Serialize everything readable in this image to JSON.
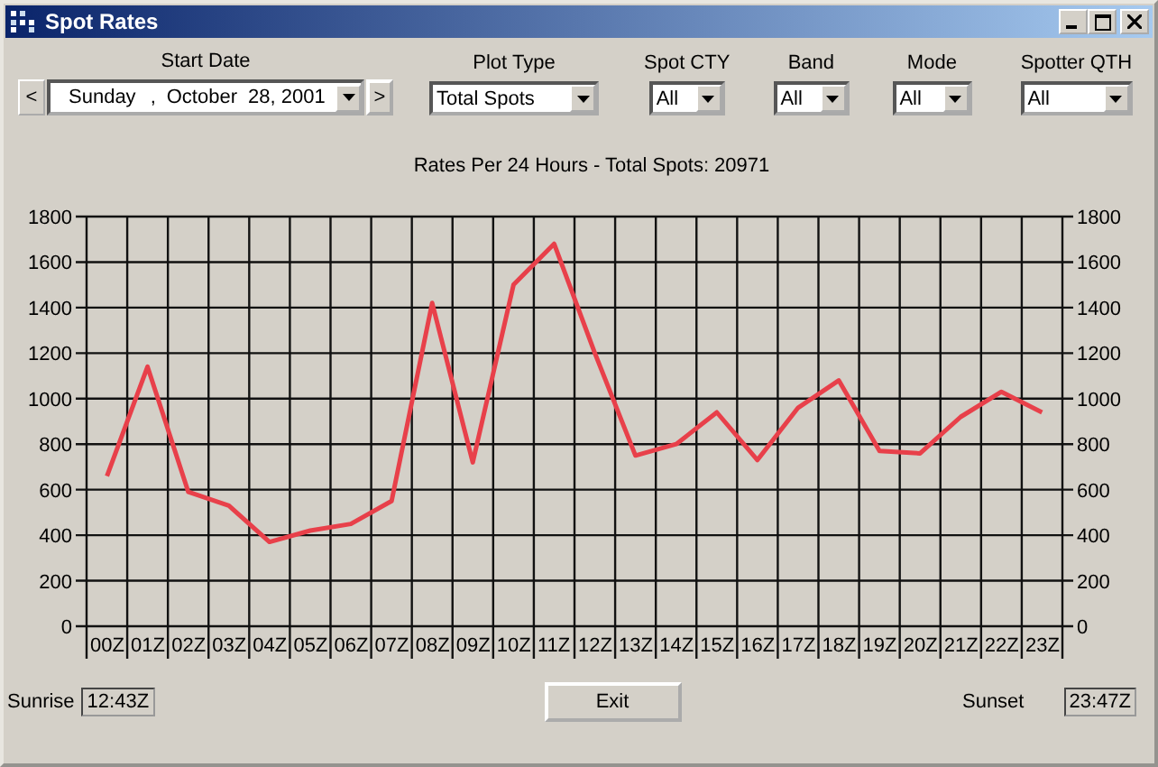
{
  "window": {
    "title": "Spot Rates"
  },
  "start_date": {
    "label": "Start Date",
    "prev": "<",
    "next": ">",
    "day": "Sunday",
    "separator": ",",
    "month": "October",
    "date": "28, 2001"
  },
  "filters": [
    {
      "label": "Plot Type",
      "value": "Total Spots"
    },
    {
      "label": "Spot CTY",
      "value": "All"
    },
    {
      "label": "Band",
      "value": "All"
    },
    {
      "label": "Mode",
      "value": "All"
    },
    {
      "label": "Spotter QTH",
      "value": "All"
    }
  ],
  "chart_data": {
    "type": "line",
    "title": "Rates Per 24 Hours - Total Spots: 20971",
    "categories": [
      "00Z",
      "01Z",
      "02Z",
      "03Z",
      "04Z",
      "05Z",
      "06Z",
      "07Z",
      "08Z",
      "09Z",
      "10Z",
      "11Z",
      "12Z",
      "13Z",
      "14Z",
      "15Z",
      "16Z",
      "17Z",
      "18Z",
      "19Z",
      "20Z",
      "21Z",
      "22Z",
      "23Z"
    ],
    "series": [
      {
        "color": "#e8404a",
        "values": [
          660,
          1140,
          590,
          530,
          370,
          420,
          450,
          550,
          1420,
          720,
          1500,
          1680,
          1200,
          750,
          800,
          940,
          730,
          960,
          1080,
          770,
          760,
          920,
          1030,
          940
        ]
      }
    ],
    "ylim": [
      0,
      1800
    ],
    "yticks": [
      0,
      200,
      400,
      600,
      800,
      1000,
      1200,
      1400,
      1600,
      1800
    ],
    "y2lim": [
      0,
      1800
    ],
    "y2ticks": [
      0,
      200,
      400,
      600,
      800,
      1000,
      1200,
      1400,
      1600,
      1800
    ],
    "grid": true
  },
  "sunrise": {
    "label": "Sunrise",
    "value": "12:43Z"
  },
  "sunset": {
    "label": "Sunset",
    "value": "23:47Z"
  },
  "exit_button": "Exit"
}
